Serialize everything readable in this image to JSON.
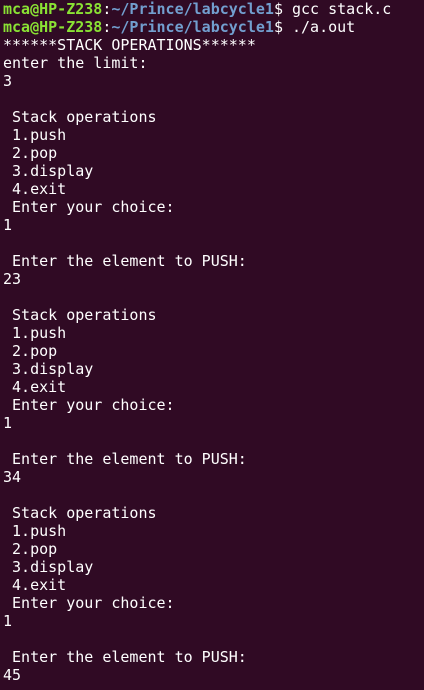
{
  "prompt": {
    "user_host": "mca@HP-Z238",
    "separator": ":",
    "path": "~/Prince/labcycle1",
    "symbol": "$ "
  },
  "commands": [
    "gcc stack.c",
    "./a.out"
  ],
  "output": [
    "******STACK OPERATIONS******",
    "enter the limit:",
    "3",
    "",
    " Stack operations",
    " 1.push",
    " 2.pop",
    " 3.display",
    " 4.exit",
    " Enter your choice:",
    "1",
    "",
    " Enter the element to PUSH:",
    "23",
    "",
    " Stack operations",
    " 1.push",
    " 2.pop",
    " 3.display",
    " 4.exit",
    " Enter your choice:",
    "1",
    "",
    " Enter the element to PUSH:",
    "34",
    "",
    " Stack operations",
    " 1.push",
    " 2.pop",
    " 3.display",
    " 4.exit",
    " Enter your choice:",
    "1",
    "",
    " Enter the element to PUSH:",
    "45"
  ]
}
